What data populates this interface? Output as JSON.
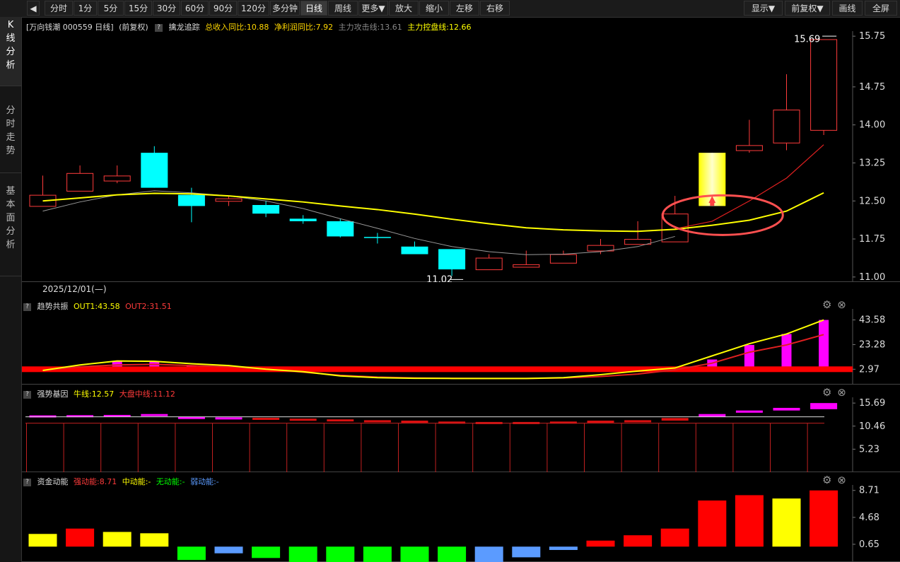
{
  "toolbar": {
    "back_icon": "back-icon",
    "buttons": [
      "分时",
      "1分",
      "5分",
      "15分",
      "30分",
      "60分",
      "90分",
      "120分",
      "多分钟",
      "日线",
      "周线",
      "更多▼",
      "放大",
      "缩小",
      "左移",
      "右移"
    ],
    "active": "日线",
    "right_buttons": [
      "显示▼",
      "前复权▼",
      "画线",
      "全屏"
    ]
  },
  "sidebar": [
    "K线分析",
    "分时走势",
    "基本面分析"
  ],
  "main_header": {
    "stock": "[万向钱潮 000559 日线]",
    "adjust": "(前复权)",
    "indicator": "擒龙追踪",
    "revenue": "总收入同比:10.88",
    "profit": "净利润同比:7.92",
    "attack": "主力攻击线:13.61",
    "control": "主力控盘线:12.66"
  },
  "date_label": "2025/12/01(—)",
  "panel2": {
    "name": "趋势共振",
    "out1": "OUT1:43.58",
    "out2": "OUT2:31.51",
    "axis": [
      "43.58",
      "23.28",
      "2.97"
    ]
  },
  "panel3": {
    "name": "强势基因",
    "bull": "牛线:12.57",
    "market": "大盘中线:11.12",
    "axis": [
      "15.69",
      "10.46",
      "5.23"
    ]
  },
  "panel4": {
    "name": "资金动能",
    "strong": "强动能:8.71",
    "mid": "中动能:-",
    "none": "无动能:-",
    "weak": "弱动能:-",
    "axis": [
      "8.71",
      "4.68",
      "0.65"
    ]
  },
  "colors": {
    "up": "#ff3b3b",
    "down": "#00ffff",
    "yellow": "#ffff00",
    "green": "#00ff00",
    "blue": "#5b9bff",
    "magenta": "#ff00ff"
  },
  "chart_data": {
    "type": "candlestick",
    "ylim": [
      10.9,
      15.85
    ],
    "y_ticks": [
      "15.75",
      "14.75",
      "14.00",
      "13.25",
      "12.50",
      "11.75",
      "11.00"
    ],
    "annotations": {
      "high": "15.69",
      "low": "11.02"
    },
    "candles": [
      {
        "o": 12.4,
        "c": 12.62,
        "h": 13.0,
        "l": 12.4
      },
      {
        "o": 12.7,
        "c": 13.05,
        "h": 13.2,
        "l": 12.7
      },
      {
        "o": 12.9,
        "c": 13.0,
        "h": 13.2,
        "l": 12.85
      },
      {
        "o": 13.45,
        "c": 12.76,
        "h": 13.58,
        "l": 12.76
      },
      {
        "o": 12.62,
        "c": 12.4,
        "h": 12.76,
        "l": 12.08
      },
      {
        "o": 12.5,
        "c": 12.55,
        "h": 12.6,
        "l": 12.4
      },
      {
        "o": 12.42,
        "c": 12.25,
        "h": 12.5,
        "l": 12.18
      },
      {
        "o": 12.15,
        "c": 12.1,
        "h": 12.22,
        "l": 12.05
      },
      {
        "o": 12.1,
        "c": 11.8,
        "h": 12.15,
        "l": 11.78
      },
      {
        "o": 11.79,
        "c": 11.78,
        "h": 11.87,
        "l": 11.66
      },
      {
        "o": 11.6,
        "c": 11.45,
        "h": 11.7,
        "l": 11.45
      },
      {
        "o": 11.55,
        "c": 11.15,
        "h": 11.55,
        "l": 11.02
      },
      {
        "o": 11.15,
        "c": 11.38,
        "h": 11.45,
        "l": 11.15
      },
      {
        "o": 11.2,
        "c": 11.25,
        "h": 11.52,
        "l": 11.2
      },
      {
        "o": 11.28,
        "c": 11.45,
        "h": 11.52,
        "l": 11.28
      },
      {
        "o": 11.52,
        "c": 11.63,
        "h": 11.75,
        "l": 11.45
      },
      {
        "o": 11.65,
        "c": 11.75,
        "h": 12.1,
        "l": 11.65
      },
      {
        "o": 11.7,
        "c": 12.25,
        "h": 12.6,
        "l": 11.7
      },
      {
        "o": 13.45,
        "c": 12.4,
        "h": 13.45,
        "l": 12.4
      },
      {
        "o": 13.5,
        "c": 13.6,
        "h": 14.1,
        "l": 13.45
      },
      {
        "o": 13.65,
        "c": 14.3,
        "h": 15.0,
        "l": 13.5
      },
      {
        "o": 13.9,
        "c": 15.69,
        "h": 15.69,
        "l": 13.8
      }
    ],
    "yellow_line": [
      12.5,
      12.56,
      12.62,
      12.65,
      12.64,
      12.6,
      12.54,
      12.48,
      12.4,
      12.33,
      12.24,
      12.14,
      12.05,
      11.97,
      11.93,
      11.91,
      11.9,
      11.94,
      12.02,
      12.12,
      12.3,
      12.66
    ],
    "gray_line": [
      12.3,
      12.48,
      12.62,
      12.7,
      12.66,
      12.6,
      12.5,
      12.35,
      12.15,
      11.96,
      11.76,
      11.6,
      11.5,
      11.44,
      11.45,
      11.5,
      11.6,
      11.8
    ],
    "red_line": [
      11.95,
      12.1,
      12.5,
      12.95,
      13.61
    ],
    "red_line_start": 17
  },
  "panel2_data": {
    "ylim": [
      -5,
      48
    ],
    "out1": [
      2.0,
      6.5,
      9.8,
      9.5,
      7.5,
      6.0,
      3.0,
      1.0,
      -2.5,
      -4.0,
      -4.5,
      -4.6,
      -4.6,
      -4.6,
      -4.0,
      -1.5,
      1.5,
      4.0,
      14.0,
      24.0,
      32.0,
      43.58
    ],
    "out2": [
      2.0,
      5.0,
      6.5,
      7.0,
      6.0,
      5.0,
      3.0,
      0.5,
      -2.0,
      -3.5,
      -4.2,
      -4.5,
      -4.6,
      -4.6,
      -4.2,
      -3.0,
      -1.0,
      2.5,
      8.0,
      17.0,
      23.0,
      31.51
    ],
    "bars": [
      null,
      5.0,
      9.5,
      9.0,
      6.0,
      5.0,
      null,
      null,
      null,
      null,
      null,
      null,
      null,
      null,
      null,
      null,
      null,
      null,
      11.0,
      23.0,
      32.0,
      43.58
    ],
    "base": 2.97
  },
  "panel3_data": {
    "ylim": [
      0,
      17
    ],
    "boxes": [
      {
        "top": 12.9,
        "bot": 12.5,
        "c": "m"
      },
      {
        "top": 12.95,
        "bot": 12.55,
        "c": "m"
      },
      {
        "top": 13.0,
        "bot": 12.6,
        "c": "m"
      },
      {
        "top": 13.2,
        "bot": 12.75,
        "c": "m"
      },
      {
        "top": 12.55,
        "bot": 12.15,
        "c": "m"
      },
      {
        "top": 12.45,
        "bot": 12.05,
        "c": "m"
      },
      {
        "top": 12.35,
        "bot": 11.95,
        "c": "r"
      },
      {
        "top": 12.15,
        "bot": 11.8,
        "c": "r"
      },
      {
        "top": 12.0,
        "bot": 11.6,
        "c": "r"
      },
      {
        "top": 11.8,
        "bot": 11.5,
        "c": "r"
      },
      {
        "top": 11.7,
        "bot": 11.4,
        "c": "r"
      },
      {
        "top": 11.5,
        "bot": 11.0,
        "c": "r"
      },
      {
        "top": 11.4,
        "bot": 11.0,
        "c": "r"
      },
      {
        "top": 11.4,
        "bot": 11.0,
        "c": "r"
      },
      {
        "top": 11.5,
        "bot": 11.1,
        "c": "r"
      },
      {
        "top": 11.7,
        "bot": 11.3,
        "c": "r"
      },
      {
        "top": 11.8,
        "bot": 11.4,
        "c": "r"
      },
      {
        "top": 12.3,
        "bot": 11.7,
        "c": "r"
      },
      {
        "top": 13.2,
        "bot": 12.5,
        "c": "m"
      },
      {
        "top": 14.0,
        "bot": 13.5,
        "c": "m"
      },
      {
        "top": 14.6,
        "bot": 14.0,
        "c": "m"
      },
      {
        "top": 15.69,
        "bot": 14.3,
        "c": "m"
      }
    ],
    "bull_line": 12.57,
    "market_line": 11.12
  },
  "panel4_data": {
    "ylim": [
      -2,
      9
    ],
    "bars": [
      {
        "v": 2.2,
        "c": "y"
      },
      {
        "v": 3.0,
        "c": "r"
      },
      {
        "v": 2.5,
        "c": "y"
      },
      {
        "v": 2.3,
        "c": "y"
      },
      {
        "v": -2.0,
        "c": "g"
      },
      {
        "v": -1.0,
        "c": "b"
      },
      {
        "v": -1.7,
        "c": "g"
      },
      {
        "v": -2.3,
        "c": "g"
      },
      {
        "v": -2.8,
        "c": "g"
      },
      {
        "v": -2.8,
        "c": "g"
      },
      {
        "v": -3.2,
        "c": "g"
      },
      {
        "v": -3.3,
        "c": "g"
      },
      {
        "v": -2.6,
        "c": "b"
      },
      {
        "v": -1.6,
        "c": "b"
      },
      {
        "v": -0.5,
        "c": "b"
      },
      {
        "v": 1.2,
        "c": "r"
      },
      {
        "v": 2.0,
        "c": "r"
      },
      {
        "v": 3.0,
        "c": "r"
      },
      {
        "v": 7.2,
        "c": "r"
      },
      {
        "v": 8.0,
        "c": "r"
      },
      {
        "v": 7.5,
        "c": "y"
      },
      {
        "v": 8.71,
        "c": "r"
      }
    ]
  }
}
